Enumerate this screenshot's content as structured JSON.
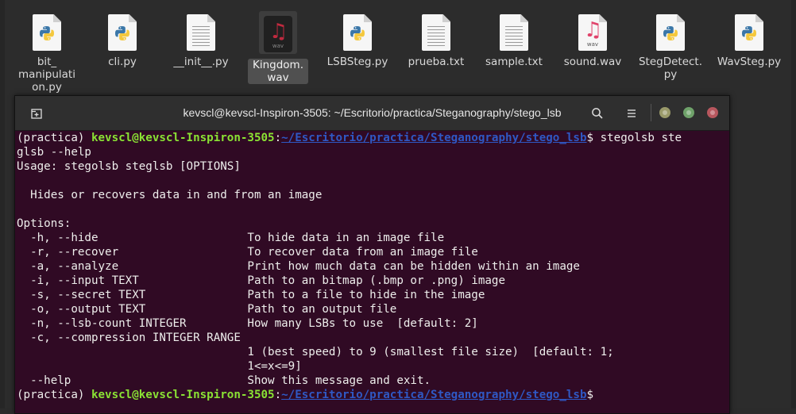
{
  "desktop": {
    "icons": [
      {
        "name": "bit_manipulation.py",
        "label": "bit_\nmanipulati\non.py",
        "type": "python"
      },
      {
        "name": "cli.py",
        "label": "cli.py",
        "type": "python"
      },
      {
        "name": "__init__.py",
        "label": "__init__.py",
        "type": "text"
      },
      {
        "name": "Kingdom.wav",
        "label": "Kingdom.\nwav",
        "type": "audio-dark",
        "selected": true
      },
      {
        "name": "LSBSteg.py",
        "label": "LSBSteg.py",
        "type": "python"
      },
      {
        "name": "prueba.txt",
        "label": "prueba.txt",
        "type": "text"
      },
      {
        "name": "sample.txt",
        "label": "sample.txt",
        "type": "text"
      },
      {
        "name": "sound.wav",
        "label": "sound.wav",
        "type": "audio"
      },
      {
        "name": "StegDetect.py",
        "label": "StegDetect.\npy",
        "type": "python"
      },
      {
        "name": "WavSteg.py",
        "label": "WavSteg.py",
        "type": "python"
      }
    ],
    "wav_tag": "wav"
  },
  "terminal": {
    "title": "kevscl@kevscl-Inspiron-3505: ~/Escritorio/practica/Steganography/stego_lsb",
    "icons": {
      "new_tab": "new-tab-icon",
      "search": "search-icon",
      "menu": "hamburger-menu-icon"
    },
    "colors": {
      "background": "#300a24",
      "prompt_user": "#8ae234",
      "prompt_path": "#2f58c4",
      "text": "#eeeeec"
    },
    "prompt": {
      "env": "(practica) ",
      "user": "kevscl@kevscl-Inspiron-3505",
      "colon": ":",
      "path": "~/Escritorio/practica/Steganography/stego_lsb",
      "dollar": "$"
    },
    "command_first": " stegolsb ste",
    "command_wrap": "glsb --help",
    "output": [
      "Usage: stegolsb steglsb [OPTIONS]",
      "",
      "  Hides or recovers data in and from an image",
      "",
      "Options:",
      "  -h, --hide                      To hide data in an image file",
      "  -r, --recover                   To recover data from an image file",
      "  -a, --analyze                   Print how much data can be hidden within an image",
      "  -i, --input TEXT                Path to an bitmap (.bmp or .png) image",
      "  -s, --secret TEXT               Path to a file to hide in the image",
      "  -o, --output TEXT               Path to an output file",
      "  -n, --lsb-count INTEGER         How many LSBs to use  [default: 2]",
      "  -c, --compression INTEGER RANGE",
      "                                  1 (best speed) to 9 (smallest file size)  [default: 1;",
      "                                  1<=x<=9]",
      "  --help                          Show this message and exit."
    ]
  }
}
